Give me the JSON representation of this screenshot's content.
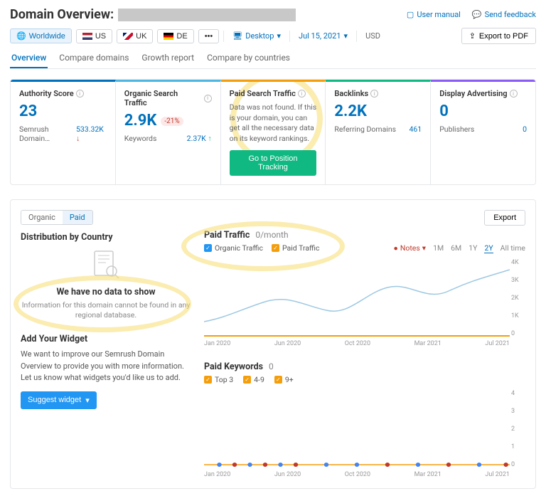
{
  "header": {
    "title": "Domain Overview:",
    "user_manual": "User manual",
    "send_feedback": "Send feedback"
  },
  "filters": {
    "worldwide": "Worldwide",
    "countries": [
      {
        "code": "us",
        "label": "US"
      },
      {
        "code": "uk",
        "label": "UK"
      },
      {
        "code": "de",
        "label": "DE"
      }
    ],
    "more": "•••",
    "device": "Desktop",
    "date": "Jul 15, 2021",
    "currency": "USD",
    "export_pdf": "Export to PDF"
  },
  "tabs": [
    "Overview",
    "Compare domains",
    "Growth report",
    "Compare by countries"
  ],
  "metrics": {
    "authority": {
      "title": "Authority Score",
      "value": "23",
      "sub_label": "Semrush Domain…",
      "sub_value": "533.32K",
      "trend": "down"
    },
    "organic": {
      "title": "Organic Search Traffic",
      "value": "2.9K",
      "badge": "-21%",
      "sub_label": "Keywords",
      "sub_value": "2.37K",
      "trend": "up"
    },
    "paid": {
      "title": "Paid Search Traffic",
      "message": "Data was not found. If this is your domain, you can get all the necessary data on its keyword rankings.",
      "cta": "Go to Position Tracking"
    },
    "backlinks": {
      "title": "Backlinks",
      "value": "2.2K",
      "sub_label": "Referring Domains",
      "sub_value": "461"
    },
    "display": {
      "title": "Display Advertising",
      "value": "0",
      "sub_label": "Publishers",
      "sub_value": "0"
    }
  },
  "toggle": {
    "organic": "Organic",
    "paid": "Paid"
  },
  "distribution": {
    "title": "Distribution by Country",
    "no_data_title": "We have no data to show",
    "no_data_msg": "Information for this domain cannot be found in any regional database."
  },
  "widget": {
    "title": "Add Your Widget",
    "msg": "We want to improve our Semrush Domain Overview to provide you with more information. Let us know what widgets you'd like us to add.",
    "cta": "Suggest widget"
  },
  "export": "Export",
  "paid_traffic": {
    "title": "Paid Traffic",
    "value": "0/month",
    "legend_organic": "Organic Traffic",
    "legend_paid": "Paid Traffic",
    "notes": "Notes",
    "ranges": [
      "1M",
      "6M",
      "1Y",
      "2Y",
      "All time"
    ],
    "active_range": "2Y"
  },
  "paid_keywords": {
    "title": "Paid Keywords",
    "value": "0",
    "legend": [
      "Top 3",
      "4-9",
      "9+"
    ]
  },
  "chart_data": [
    {
      "type": "line",
      "title": "Paid Traffic 0/month",
      "x": [
        "Jan 2020",
        "Jun 2020",
        "Oct 2020",
        "Mar 2021",
        "Jul 2021"
      ],
      "series": [
        {
          "name": "Organic Traffic",
          "values": [
            900,
            1700,
            1400,
            2600,
            3400
          ]
        },
        {
          "name": "Paid Traffic",
          "values": [
            0,
            0,
            0,
            0,
            0
          ]
        }
      ],
      "ylim": [
        0,
        4000
      ],
      "yticks": [
        "0",
        "1K",
        "2K",
        "3K",
        "4K"
      ]
    },
    {
      "type": "line",
      "title": "Paid Keywords 0",
      "x": [
        "Jan 2020",
        "Jun 2020",
        "Oct 2020",
        "Mar 2021",
        "Jul 2021"
      ],
      "series": [
        {
          "name": "Top 3",
          "values": [
            0,
            0,
            0,
            0,
            0
          ]
        },
        {
          "name": "4-9",
          "values": [
            0,
            0,
            0,
            0,
            0
          ]
        },
        {
          "name": "9+",
          "values": [
            0,
            0,
            0,
            0,
            0
          ]
        }
      ],
      "ylim": [
        0,
        4
      ],
      "yticks": [
        "0",
        "1",
        "2",
        "3",
        "4"
      ]
    }
  ]
}
